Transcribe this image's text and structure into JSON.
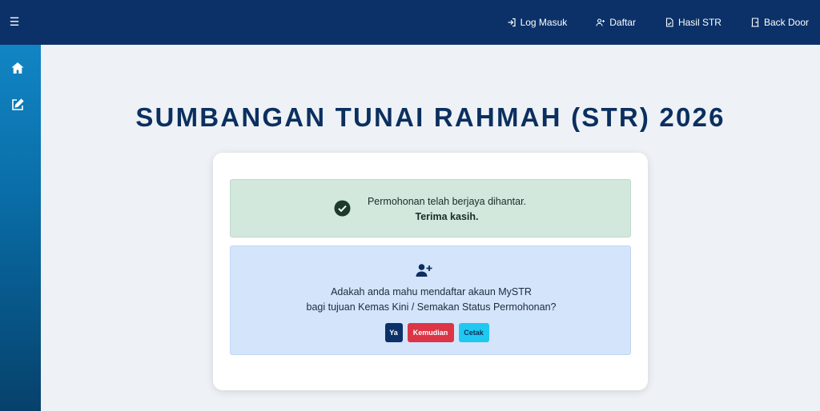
{
  "topbar": {
    "menu_icon": "hamburger-icon",
    "nav": [
      {
        "label": "Log Masuk",
        "icon": "login-icon"
      },
      {
        "label": "Daftar",
        "icon": "user-plus-icon"
      },
      {
        "label": "Hasil STR",
        "icon": "document-icon"
      },
      {
        "label": "Back Door",
        "icon": "door-icon"
      }
    ]
  },
  "sidebar": {
    "items": [
      {
        "icon": "home-icon"
      },
      {
        "icon": "edit-icon"
      }
    ]
  },
  "main": {
    "title": "SUMBANGAN TUNAI RAHMAH (STR) 2026",
    "success": {
      "line1": "Permohonan telah berjaya dihantar.",
      "line2": "Terima kasih.",
      "icon": "check-circle-icon"
    },
    "register": {
      "icon": "user-plus-icon",
      "line1": "Adakah anda mahu mendaftar akaun MySTR",
      "line2": "bagi tujuan Kemas Kini / Semakan Status Permohonan?",
      "buttons": {
        "yes": "Ya",
        "later": "Kemudian",
        "print": "Cetak"
      }
    }
  },
  "colors": {
    "topbar": "#0b3168",
    "title": "#0b2f5f",
    "success_bg": "#d2e8dd",
    "info_bg": "#d4e4fb",
    "btn_yes": "#0b3168",
    "btn_later": "#dc3545",
    "btn_print": "#1fc8f0"
  }
}
